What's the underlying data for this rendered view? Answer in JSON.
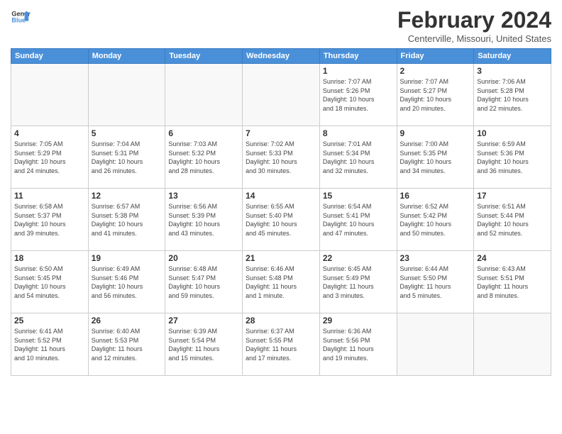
{
  "header": {
    "logo_line1": "General",
    "logo_line2": "Blue",
    "main_title": "February 2024",
    "subtitle": "Centerville, Missouri, United States"
  },
  "weekdays": [
    "Sunday",
    "Monday",
    "Tuesday",
    "Wednesday",
    "Thursday",
    "Friday",
    "Saturday"
  ],
  "weeks": [
    [
      {
        "day": "",
        "info": ""
      },
      {
        "day": "",
        "info": ""
      },
      {
        "day": "",
        "info": ""
      },
      {
        "day": "",
        "info": ""
      },
      {
        "day": "1",
        "info": "Sunrise: 7:07 AM\nSunset: 5:26 PM\nDaylight: 10 hours\nand 18 minutes."
      },
      {
        "day": "2",
        "info": "Sunrise: 7:07 AM\nSunset: 5:27 PM\nDaylight: 10 hours\nand 20 minutes."
      },
      {
        "day": "3",
        "info": "Sunrise: 7:06 AM\nSunset: 5:28 PM\nDaylight: 10 hours\nand 22 minutes."
      }
    ],
    [
      {
        "day": "4",
        "info": "Sunrise: 7:05 AM\nSunset: 5:29 PM\nDaylight: 10 hours\nand 24 minutes."
      },
      {
        "day": "5",
        "info": "Sunrise: 7:04 AM\nSunset: 5:31 PM\nDaylight: 10 hours\nand 26 minutes."
      },
      {
        "day": "6",
        "info": "Sunrise: 7:03 AM\nSunset: 5:32 PM\nDaylight: 10 hours\nand 28 minutes."
      },
      {
        "day": "7",
        "info": "Sunrise: 7:02 AM\nSunset: 5:33 PM\nDaylight: 10 hours\nand 30 minutes."
      },
      {
        "day": "8",
        "info": "Sunrise: 7:01 AM\nSunset: 5:34 PM\nDaylight: 10 hours\nand 32 minutes."
      },
      {
        "day": "9",
        "info": "Sunrise: 7:00 AM\nSunset: 5:35 PM\nDaylight: 10 hours\nand 34 minutes."
      },
      {
        "day": "10",
        "info": "Sunrise: 6:59 AM\nSunset: 5:36 PM\nDaylight: 10 hours\nand 36 minutes."
      }
    ],
    [
      {
        "day": "11",
        "info": "Sunrise: 6:58 AM\nSunset: 5:37 PM\nDaylight: 10 hours\nand 39 minutes."
      },
      {
        "day": "12",
        "info": "Sunrise: 6:57 AM\nSunset: 5:38 PM\nDaylight: 10 hours\nand 41 minutes."
      },
      {
        "day": "13",
        "info": "Sunrise: 6:56 AM\nSunset: 5:39 PM\nDaylight: 10 hours\nand 43 minutes."
      },
      {
        "day": "14",
        "info": "Sunrise: 6:55 AM\nSunset: 5:40 PM\nDaylight: 10 hours\nand 45 minutes."
      },
      {
        "day": "15",
        "info": "Sunrise: 6:54 AM\nSunset: 5:41 PM\nDaylight: 10 hours\nand 47 minutes."
      },
      {
        "day": "16",
        "info": "Sunrise: 6:52 AM\nSunset: 5:42 PM\nDaylight: 10 hours\nand 50 minutes."
      },
      {
        "day": "17",
        "info": "Sunrise: 6:51 AM\nSunset: 5:44 PM\nDaylight: 10 hours\nand 52 minutes."
      }
    ],
    [
      {
        "day": "18",
        "info": "Sunrise: 6:50 AM\nSunset: 5:45 PM\nDaylight: 10 hours\nand 54 minutes."
      },
      {
        "day": "19",
        "info": "Sunrise: 6:49 AM\nSunset: 5:46 PM\nDaylight: 10 hours\nand 56 minutes."
      },
      {
        "day": "20",
        "info": "Sunrise: 6:48 AM\nSunset: 5:47 PM\nDaylight: 10 hours\nand 59 minutes."
      },
      {
        "day": "21",
        "info": "Sunrise: 6:46 AM\nSunset: 5:48 PM\nDaylight: 11 hours\nand 1 minute."
      },
      {
        "day": "22",
        "info": "Sunrise: 6:45 AM\nSunset: 5:49 PM\nDaylight: 11 hours\nand 3 minutes."
      },
      {
        "day": "23",
        "info": "Sunrise: 6:44 AM\nSunset: 5:50 PM\nDaylight: 11 hours\nand 5 minutes."
      },
      {
        "day": "24",
        "info": "Sunrise: 6:43 AM\nSunset: 5:51 PM\nDaylight: 11 hours\nand 8 minutes."
      }
    ],
    [
      {
        "day": "25",
        "info": "Sunrise: 6:41 AM\nSunset: 5:52 PM\nDaylight: 11 hours\nand 10 minutes."
      },
      {
        "day": "26",
        "info": "Sunrise: 6:40 AM\nSunset: 5:53 PM\nDaylight: 11 hours\nand 12 minutes."
      },
      {
        "day": "27",
        "info": "Sunrise: 6:39 AM\nSunset: 5:54 PM\nDaylight: 11 hours\nand 15 minutes."
      },
      {
        "day": "28",
        "info": "Sunrise: 6:37 AM\nSunset: 5:55 PM\nDaylight: 11 hours\nand 17 minutes."
      },
      {
        "day": "29",
        "info": "Sunrise: 6:36 AM\nSunset: 5:56 PM\nDaylight: 11 hours\nand 19 minutes."
      },
      {
        "day": "",
        "info": ""
      },
      {
        "day": "",
        "info": ""
      }
    ]
  ]
}
